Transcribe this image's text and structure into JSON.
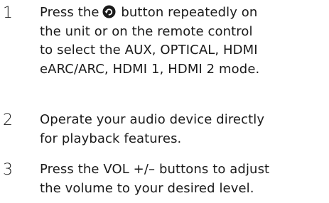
{
  "steps": [
    {
      "number": "1",
      "line1_before": "Press the",
      "icon": "source-icon",
      "line1_after": "button repeatedly on",
      "line2": "the unit or on the remote control",
      "line3": "to select the AUX, OPTICAL, HDMI",
      "line4": "eARC/ARC, HDMI 1, HDMI 2 mode."
    },
    {
      "number": "2",
      "line1": "Operate your audio device directly",
      "line2": "for playback features."
    },
    {
      "number": "3",
      "line1": "Press the VOL +/– buttons to adjust",
      "line2": "the volume to your desired level."
    }
  ]
}
